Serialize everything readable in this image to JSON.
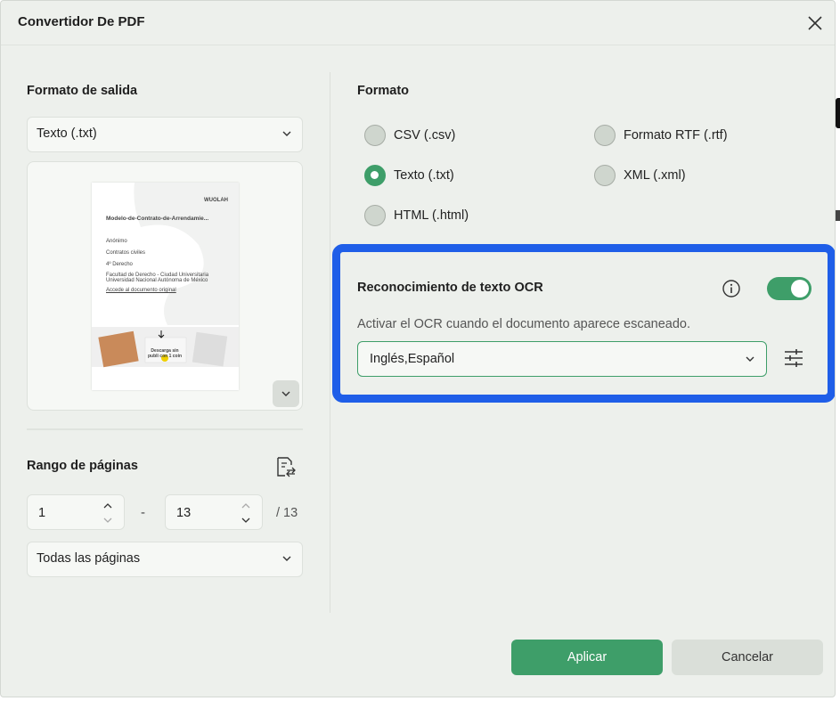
{
  "dialog": {
    "title": "Convertidor De PDF"
  },
  "left": {
    "output_heading": "Formato de salida",
    "output_select": "Texto (.txt)",
    "preview": {
      "brand": "WUOLAH",
      "doc_title": "Modelo-de-Contrato-de-Arrendamie...",
      "rows": [
        "Anónimo",
        "Contratos civiles",
        "4º Derecho",
        "Facultad de Derecho - Ciudad Universitaria",
        "Universidad Nacional Autónoma de México",
        "Accede al documento original"
      ],
      "promo": "Descarga sin publi con 1 coin"
    },
    "range_heading": "Rango de páginas",
    "from_page": "1",
    "dash": "-",
    "to_page": "13",
    "total_pages": "/ 13",
    "pages_select": "Todas las páginas"
  },
  "right": {
    "format_heading": "Formato",
    "formats": [
      {
        "label": "CSV (.csv)",
        "selected": false
      },
      {
        "label": "Formato RTF (.rtf)",
        "selected": false
      },
      {
        "label": "Texto (.txt)",
        "selected": true
      },
      {
        "label": "XML (.xml)",
        "selected": false
      },
      {
        "label": "HTML (.html)",
        "selected": false
      }
    ],
    "ocr": {
      "title": "Reconocimiento de texto OCR",
      "enabled": true,
      "description": "Activar el OCR cuando el documento aparece escaneado.",
      "languages": "Inglés,Español"
    }
  },
  "footer": {
    "apply": "Aplicar",
    "cancel": "Cancelar"
  },
  "colors": {
    "accent": "#3e9e69",
    "highlight": "#1f5ee8",
    "background": "#edf0ec"
  }
}
